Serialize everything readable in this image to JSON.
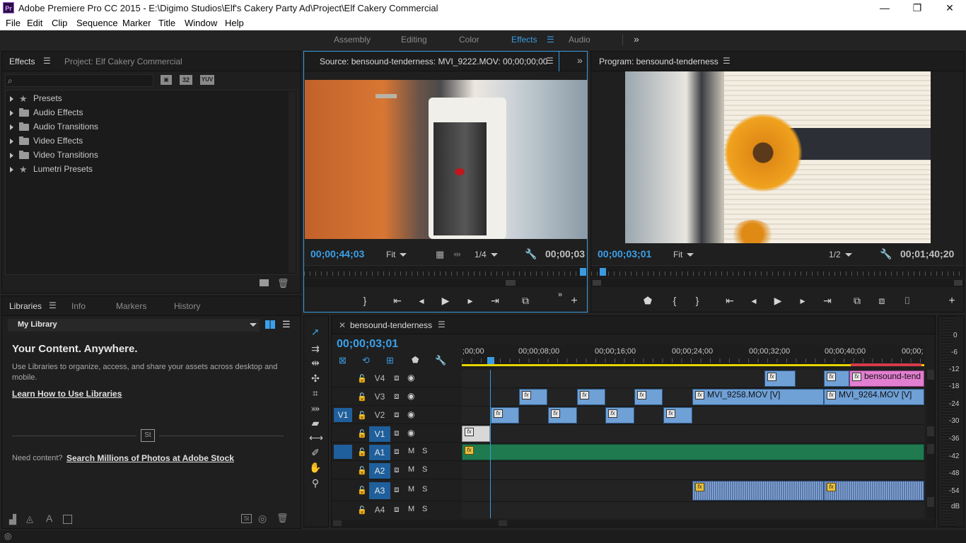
{
  "window": {
    "app_icon": "Pr",
    "title": "Adobe Premiere Pro CC 2015 - E:\\Digimo Studios\\Elf's Cakery Party Ad\\Project\\Elf Cakery Commercial",
    "minimize": "—",
    "maximize": "❐",
    "close": "✕"
  },
  "menu": [
    "File",
    "Edit",
    "Clip",
    "Sequence",
    "Marker",
    "Title",
    "Window",
    "Help"
  ],
  "workspaces": {
    "items": [
      "Assembly",
      "Editing",
      "Color",
      "Effects",
      "Audio"
    ],
    "active": "Effects",
    "overflow": "»"
  },
  "effects_panel": {
    "tabs": [
      "Effects",
      "Project: Elf Cakery Commercial"
    ],
    "search_placeholder": "",
    "badges": [
      "32",
      "YUV"
    ],
    "tree": [
      {
        "label": "Presets",
        "icon": "star-folder-icon"
      },
      {
        "label": "Audio Effects",
        "icon": "folder-icon"
      },
      {
        "label": "Audio Transitions",
        "icon": "folder-icon"
      },
      {
        "label": "Video Effects",
        "icon": "folder-icon"
      },
      {
        "label": "Video Transitions",
        "icon": "folder-icon"
      },
      {
        "label": "Lumetri Presets",
        "icon": "star-folder-icon"
      }
    ]
  },
  "libraries_panel": {
    "tabs": [
      "Libraries",
      "Info",
      "Markers",
      "History"
    ],
    "library_name": "My Library",
    "heading": "Your Content. Anywhere.",
    "description": "Use Libraries to organize, access, and share your assets across desktop and mobile.",
    "learn_link": "Learn How to Use Libraries",
    "stock_badge": "St",
    "need_content": "Need content?",
    "stock_link": "Search Millions of Photos at Adobe Stock"
  },
  "source_monitor": {
    "title": "Source: bensound-tenderness: MVI_9222.MOV: 00;00;00;00",
    "timecode": "00;00;44;03",
    "fit": "Fit",
    "resolution": "1/4",
    "duration": "00;00;03"
  },
  "program_monitor": {
    "title": "Program: bensound-tenderness",
    "timecode": "00;00;03;01",
    "fit": "Fit",
    "resolution": "1/2",
    "duration": "00;01;40;20"
  },
  "timeline": {
    "sequence_name": "bensound-tenderness",
    "timecode": "00;00;03;01",
    "ruler": [
      ";00;00",
      "00;00;08;00",
      "00;00;16;00",
      "00;00;24;00",
      "00;00;32;00",
      "00;00;40;00",
      "00;00;"
    ],
    "video_tracks": [
      "V4",
      "V3",
      "V2",
      "V1"
    ],
    "audio_tracks": [
      "A1",
      "A2",
      "A3",
      "A4"
    ],
    "source_patch_video": "V1",
    "source_patch_audio": "",
    "mute": "M",
    "solo": "S",
    "clips": {
      "v3_a": "MVI_9258.MOV [V]",
      "v3_b": "MVI_9264.MOV [V]",
      "v4_pink": "bensound-tend"
    },
    "fx": "fx"
  },
  "meters": [
    "0",
    "-6",
    "-12",
    "-18",
    "-24",
    "-30",
    "-36",
    "-42",
    "-48",
    "-54",
    "dB"
  ]
}
